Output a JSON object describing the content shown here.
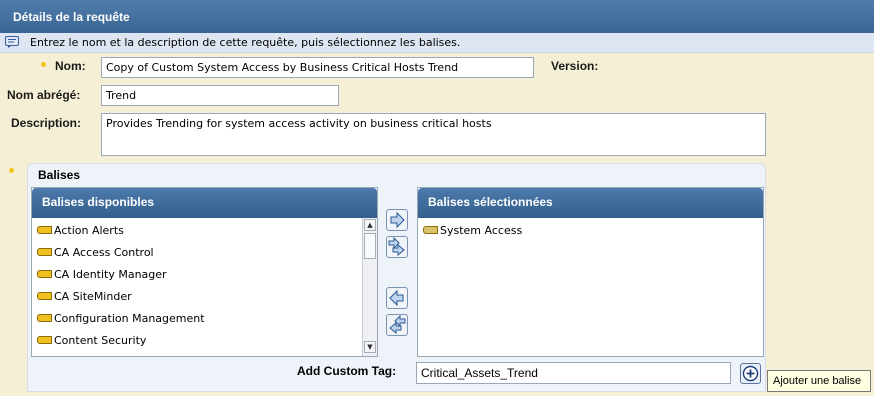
{
  "window_title": "Détails de la requête",
  "info_text": "Entrez le nom et la description de cette requête, puis sélectionnez les balises.",
  "fields": {
    "nom_label": "Nom:",
    "nom_value": "Copy of Custom System Access by Business Critical Hosts Trend",
    "version_label": "Version:",
    "nom_abrege_label": "Nom abrégé:",
    "nom_abrege_value": "Trend",
    "description_label": "Description:",
    "description_value": "Provides Trending for system access activity on business critical hosts"
  },
  "balises": {
    "title": "Balises",
    "available_title": "Balises disponibles",
    "available_items": [
      "Action Alerts",
      "CA Access Control",
      "CA Identity Manager",
      "CA SiteMinder",
      "Configuration Management",
      "Content Security"
    ],
    "selected_title": "Balises sélectionnées",
    "selected_items": [
      "System Access"
    ],
    "custom_tag_label": "Add Custom Tag:",
    "custom_tag_value": "Critical_Assets_Trend",
    "add_tooltip": "Ajouter une balise"
  },
  "icons": {
    "info": "info-icon",
    "tag": "tag-icon",
    "move_right": "arrow-right-icon",
    "move_all_right": "double-arrow-right-icon",
    "move_left": "arrow-left-icon",
    "move_all_left": "double-arrow-left-icon",
    "add": "plus-circle-icon"
  },
  "colors": {
    "header_blue": "#3a6694",
    "background": "#f5efd6",
    "required_dot": "#f5c518",
    "tag_yellow": "#f0c020"
  }
}
